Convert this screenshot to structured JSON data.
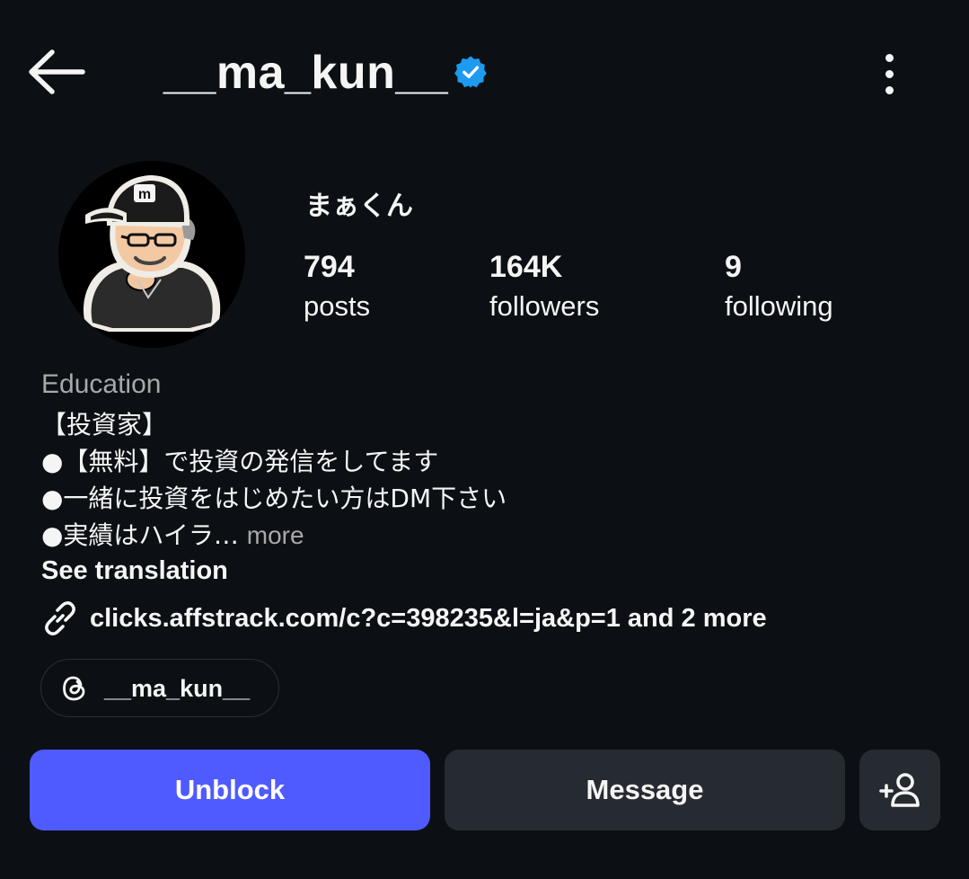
{
  "header": {
    "username": "__ma_kun__",
    "verified": true,
    "back_icon": "arrow-left-icon",
    "menu_icon": "more-vertical-icon",
    "verified_color": "#1d9bf0"
  },
  "profile": {
    "display_name": "まぁくん",
    "avatar_icon": "cartoon-avatar-image",
    "stats": {
      "posts": {
        "value": "794",
        "label": "posts"
      },
      "followers": {
        "value": "164K",
        "label": "followers"
      },
      "following": {
        "value": "9",
        "label": "following"
      }
    },
    "category": "Education",
    "bio_lines": [
      "【投資家】",
      "●【無料】で投資の発信をしてます",
      "●一緒に投資をはじめたい方はDM下さい",
      "●実績はハイラ…"
    ],
    "bio_more": "more",
    "see_translation": "See translation",
    "link": {
      "icon": "link-icon",
      "text": "clicks.affstrack.com/c?c=398235&l=ja&p=1 and 2 more"
    },
    "threads": {
      "icon": "threads-icon",
      "handle": "__ma_kun__"
    }
  },
  "actions": {
    "unblock_label": "Unblock",
    "message_label": "Message",
    "add_icon": "add-person-icon",
    "accent_color": "#4f5bff"
  }
}
